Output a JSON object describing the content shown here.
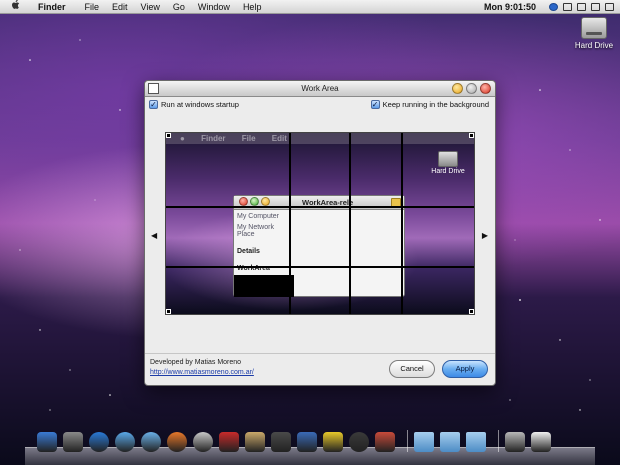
{
  "menubar": {
    "apple": "",
    "app_name": "Finder",
    "items": [
      "File",
      "Edit",
      "View",
      "Go",
      "Window",
      "Help"
    ],
    "clock": "Mon 9:01:50"
  },
  "desktop": {
    "hard_drive_label": "Hard Drive"
  },
  "window": {
    "title": "Work Area",
    "option_startup": "Run at windows startup",
    "option_background": "Keep running in the background",
    "preview": {
      "menu_app": "Finder",
      "menu_items": [
        "File",
        "Edit"
      ],
      "hard_drive_label": "Hard Drive",
      "inner_window_title": "WorkArea-rele",
      "sidebar": [
        "My Computer",
        "My Network Place"
      ],
      "details_label": "Details",
      "workarea_label": "WorkArea"
    },
    "arrow_left": "◀",
    "arrow_right": "▶",
    "credit_text": "Developed by Matias Moreno",
    "credit_link": "http://www.matiasmoreno.com.ar/",
    "cancel_label": "Cancel",
    "apply_label": "Apply"
  },
  "dock": {
    "icons": [
      {
        "name": "finder-icon",
        "color": "#3a7bd5"
      },
      {
        "name": "dashboard-icon",
        "color": "#8a8a8a"
      },
      {
        "name": "quicktime-icon",
        "color": "#2a7ad8"
      },
      {
        "name": "itunes-icon",
        "color": "#5aa8e8"
      },
      {
        "name": "safari-icon",
        "color": "#6ab0e8"
      },
      {
        "name": "firefox-icon",
        "color": "#e8782a"
      },
      {
        "name": "clock-icon",
        "color": "#c8c8c8"
      },
      {
        "name": "chair-icon",
        "color": "#c82a2a"
      },
      {
        "name": "preview-icon",
        "color": "#caa86a"
      },
      {
        "name": "terminal-icon",
        "color": "#4a4a4a"
      },
      {
        "name": "grid-icon",
        "color": "#3a6ab8"
      },
      {
        "name": "radiation-icon",
        "color": "#e8c82a"
      },
      {
        "name": "power-icon",
        "color": "#3a3a3a"
      },
      {
        "name": "photo-icon",
        "color": "#c84a3a"
      },
      {
        "name": "applications-folder-icon",
        "color": "#6aa0d8"
      },
      {
        "name": "documents-folder-icon",
        "color": "#6aa0d8"
      },
      {
        "name": "downloads-folder-icon",
        "color": "#6aa0d8"
      },
      {
        "name": "trash-icon",
        "color": "#b8b8b8"
      },
      {
        "name": "mail-icon",
        "color": "#f0f0f0"
      }
    ]
  }
}
